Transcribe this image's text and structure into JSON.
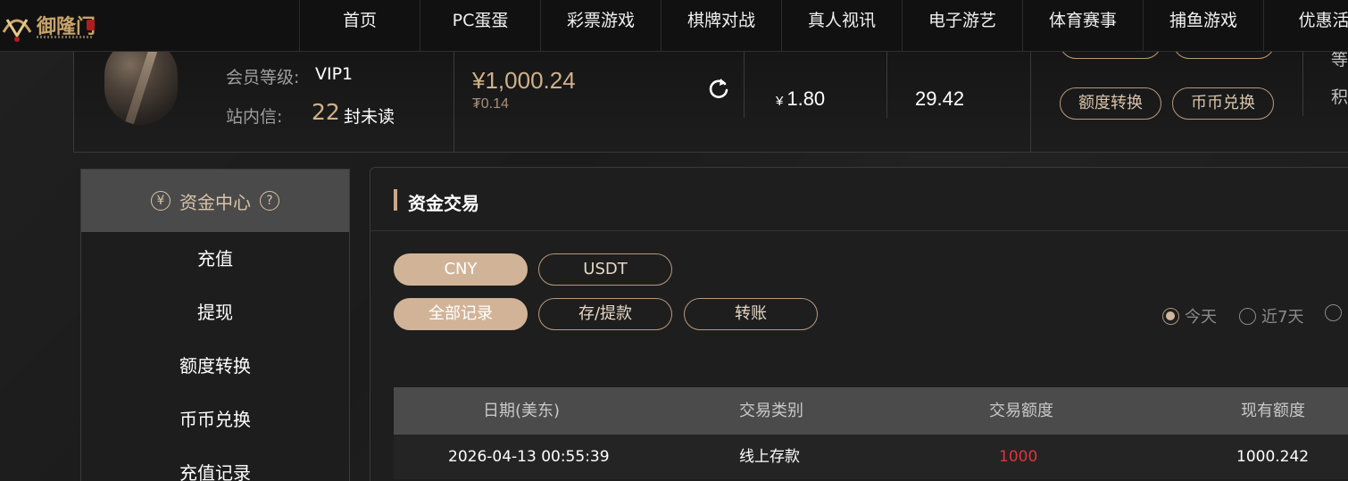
{
  "brand": {
    "name": "御隆门"
  },
  "nav": {
    "items": [
      "首页",
      "PC蛋蛋",
      "彩票游戏",
      "棋牌对战",
      "真人视讯",
      "电子游艺",
      "体育赛事",
      "捕鱼游戏",
      "优惠活"
    ]
  },
  "member": {
    "level_label": "会员等级:",
    "level_value": "VIP1",
    "message_label": "站内信:",
    "message_count": "22",
    "message_unit": "封未读",
    "balance_main": "¥1,000.24",
    "balance_sub": "₮0.14",
    "rebate_currency": "¥",
    "rebate_value": "1.80",
    "points_value": "29.42",
    "btn_transfer": "额度转换",
    "btn_exchange": "币币兑换",
    "cut_text_1": "积",
    "cut_text_2": "等"
  },
  "sidebar": {
    "title": "资金中心",
    "title_icon": "¥",
    "help_icon": "?",
    "items": [
      "充值",
      "提现",
      "额度转换",
      "币币兑换",
      "充值记录"
    ]
  },
  "main": {
    "title": "资金交易",
    "currency_tabs": [
      "CNY",
      "USDT"
    ],
    "active_currency": "CNY",
    "type_tabs": [
      "全部记录",
      "存/提款",
      "转账"
    ],
    "active_type": "全部记录",
    "date_filters": [
      "今天",
      "近7天"
    ],
    "selected_date": "今天",
    "table": {
      "headers": [
        "日期(美东)",
        "交易类别",
        "交易额度",
        "现有额度"
      ],
      "rows": [
        {
          "date": "2026-04-13 00:55:39",
          "type": "线上存款",
          "amount": "1000",
          "balance": "1000.242"
        }
      ]
    }
  },
  "colors": {
    "accent": "#d1b498",
    "amount_red": "#e0343a"
  }
}
